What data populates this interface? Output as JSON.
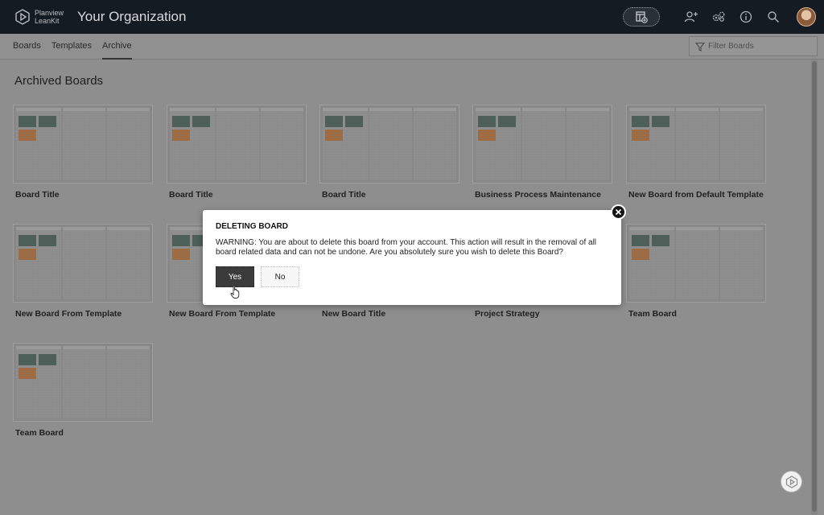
{
  "app": {
    "brand_line1": "Planview",
    "brand_line2": "LeanKit",
    "org_title": "Your Organization"
  },
  "nav": {
    "tabs": [
      {
        "label": "Boards"
      },
      {
        "label": "Templates"
      },
      {
        "label": "Archive",
        "active": true
      }
    ],
    "filter_placeholder": "Filter Boards"
  },
  "page": {
    "title": "Archived Boards"
  },
  "boards": [
    {
      "name": "Board Title"
    },
    {
      "name": "Board Title"
    },
    {
      "name": "Board Title"
    },
    {
      "name": "Business Process Maintenance"
    },
    {
      "name": "New Board from Default Template"
    },
    {
      "name": "New Board From Template"
    },
    {
      "name": "New Board From Template"
    },
    {
      "name": "New Board Title"
    },
    {
      "name": "Project Strategy"
    },
    {
      "name": "Team Board"
    },
    {
      "name": "Team Board"
    }
  ],
  "modal": {
    "title": "DELETING BOARD",
    "message": "WARNING: You are about to delete this board from your account. This action will result in the removal of all board related data and can not be undone. Are you absolutely sure you wish to delete this Board?",
    "yes_label": "Yes",
    "no_label": "No"
  },
  "icons": {
    "brand": "planview-logo-icon",
    "add_board": "add-board-icon",
    "add_user": "add-user-icon",
    "settings": "gears-icon",
    "info": "info-icon",
    "search": "search-icon",
    "filter": "funnel-icon",
    "close": "close-icon",
    "help": "planview-help-icon"
  },
  "colors": {
    "topbar": "#151b22",
    "overlay": "#8e8e8e",
    "card_green": "#4d5f58",
    "card_orange": "#9c6d45",
    "yes_button": "#3b3b3b"
  }
}
